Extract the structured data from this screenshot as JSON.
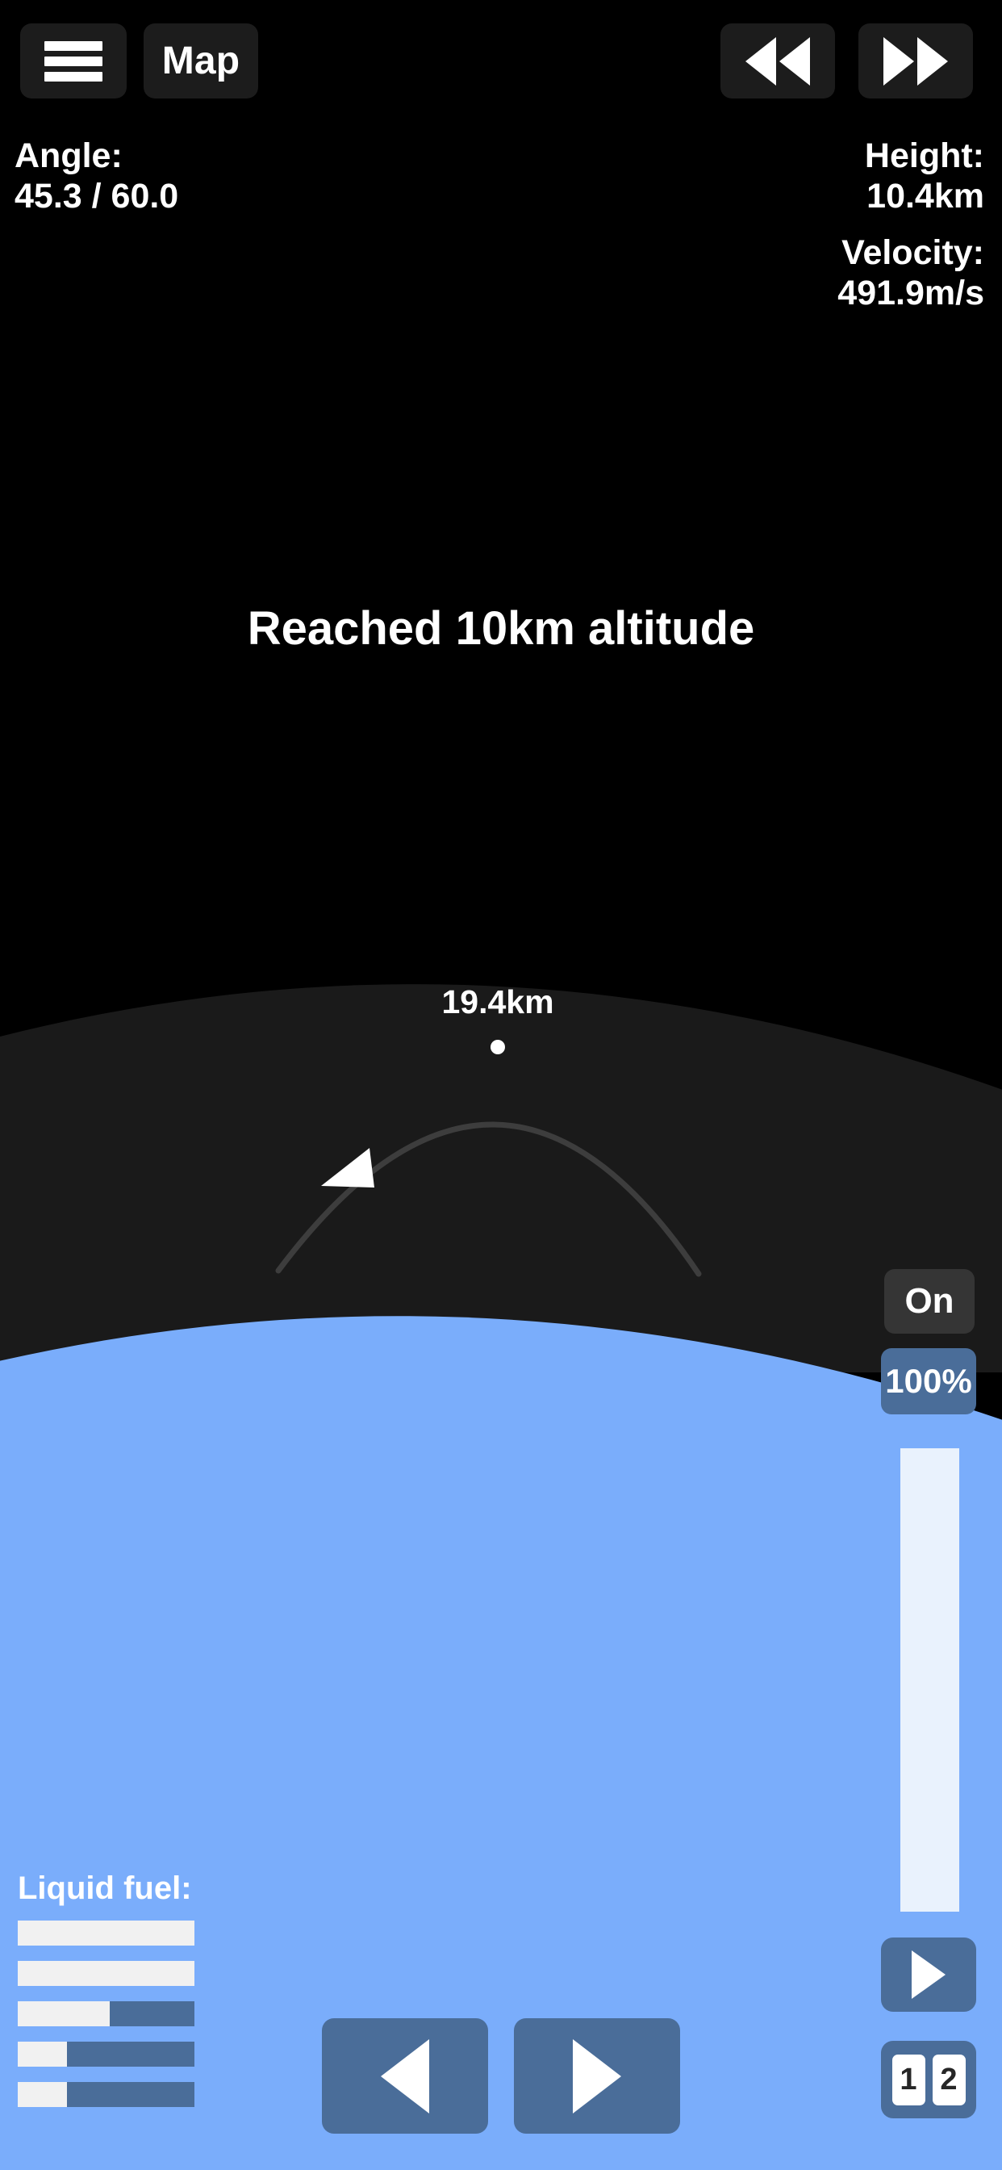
{
  "toolbar": {
    "menu_icon": "hamburger-menu-icon",
    "map_label": "Map",
    "warp_down_icon": "rewind-icon",
    "warp_up_icon": "fast-forward-icon"
  },
  "telemetry": {
    "angle_label": "Angle:",
    "angle_value": "45.3 / 60.0",
    "height_label": "Height:",
    "height_value": "10.4km",
    "velocity_label": "Velocity:",
    "velocity_value": "491.9m/s"
  },
  "event": {
    "message": "Reached 10km altitude"
  },
  "trajectory": {
    "apoapsis_label": "19.4km",
    "apoapsis_marker": "apoapsis-dot-icon",
    "craft_marker": "rocket-arrow-icon",
    "path_color": "#3d3d3d"
  },
  "engine": {
    "toggle_label": "On",
    "throttle_label": "100%",
    "throttle_percent": 100
  },
  "staging": {
    "activate_icon": "play-triangle-icon",
    "stages": [
      "1",
      "2"
    ]
  },
  "steering": {
    "rotate_left_icon": "triangle-left-icon",
    "rotate_right_icon": "triangle-right-icon"
  },
  "fuel": {
    "title": "Liquid fuel:",
    "tanks": [
      {
        "percent": 100
      },
      {
        "percent": 100
      },
      {
        "percent": 52
      },
      {
        "percent": 28
      },
      {
        "percent": 28
      }
    ]
  },
  "colors": {
    "space": "#000000",
    "atmosphere": "#1a1a1a",
    "planet": "#7aadfb",
    "panel": "#4a6d99",
    "button_dark": "#1c1c1c",
    "fuel_fill": "#f1f1f1",
    "throttle_fill": "#e9f2fd"
  }
}
